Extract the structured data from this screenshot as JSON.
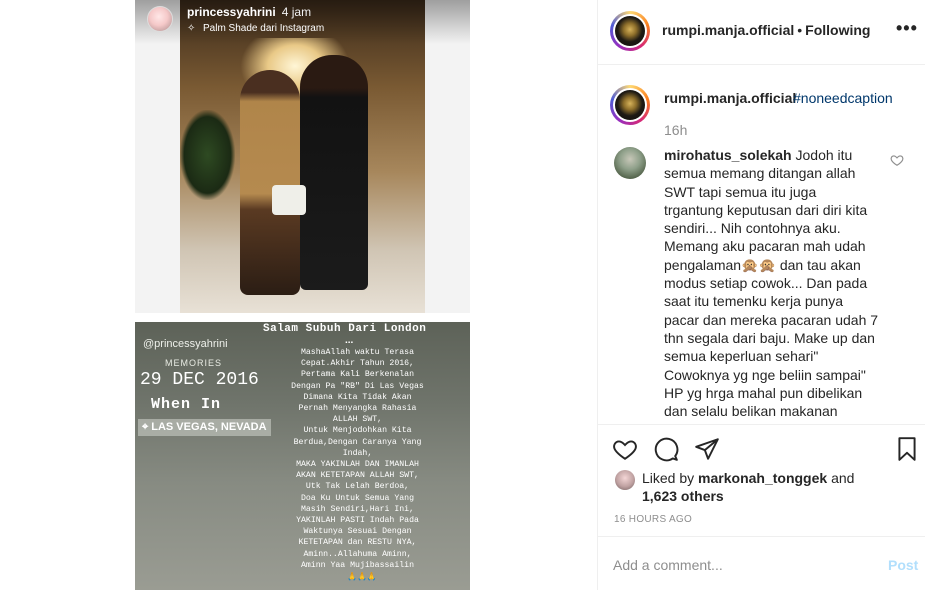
{
  "media": {
    "story1": {
      "username": "princessyahrini",
      "time": "4 jam",
      "music_icon": "sparkle-music-icon",
      "music_label": "Palm Shade dari Instagram"
    },
    "story2": {
      "handle": "@princessyahrini",
      "memories_label": "MEMORIES",
      "date": "29 DEC 2016",
      "when_in": "When In",
      "location": "LAS VEGAS, NEVADA",
      "title": "Salam Subuh Dari London",
      "dots": "...",
      "body": "MashaAllah waktu Terasa\nCepat.Akhir Tahun 2016,\nPertama Kali Berkenalan\nDengan Pa \"RB\" Di Las Vegas\nDimana Kita Tidak Akan\nPernah Menyangka Rahasia\nALLAH SWT,\nUntuk Menjodohkan Kita\nBerdua,Dengan Caranya Yang\nIndah,\nMAKA YAKINLAH DAN IMANLAH\nAKAN KETETAPAN ALLAH SWT,\nUtk Tak Lelah Berdoa,\nDoa Ku Untuk Semua Yang\nMasih Sendiri,Hari Ini,\nYAKINLAH PASTI Indah Pada\nWaktunya Sesuai Dengan\nKETETAPAN dan RESTU NYA,\nAminn..Allahuma Aminn,\nAminn Yaa Mujibassailin",
      "emoji": "🙏🙏🙏"
    }
  },
  "header": {
    "username": "rumpi.manja.official",
    "separator": "•",
    "follow_status": "Following",
    "more_label": "•••"
  },
  "caption": {
    "username": "rumpi.manja.official",
    "hashtag": "#noneedcaption",
    "time": "16h"
  },
  "comment": {
    "username": "mirohatus_solekah",
    "text": "Jodoh itu semua memang ditangan allah SWT tapi semua itu juga trgantung keputusan dari diri kita sendiri... Nih contohnya aku. Memang aku pacaran mah udah pengalaman🙊🙊 dan tau akan modus setiap cowok... Dan pada saat itu temenku kerja punya pacar dan mereka pacaran udah 7 thn segala dari baju. Make up dan semua keperluan sehari\" Cowoknya yg nge beliin sampai\" HP yg hrga mahal pun dibelikan dan selalu belikan makanan"
  },
  "actions": {
    "like_icon": "heart-icon",
    "comment_icon": "comment-bubble-icon",
    "share_icon": "paper-plane-icon",
    "save_icon": "bookmark-icon"
  },
  "likes": {
    "prefix": "Liked by ",
    "username": "markonah_tonggek",
    "suffix": " and",
    "others": "1,623 others"
  },
  "post_time": "16 HOURS AGO",
  "add_comment": {
    "placeholder": "Add a comment...",
    "post_label": "Post"
  },
  "colors": {
    "link_blue": "#00376b",
    "post_disabled": "#b2dffc",
    "secondary_text": "#8e8e8e",
    "border": "#efefef"
  }
}
